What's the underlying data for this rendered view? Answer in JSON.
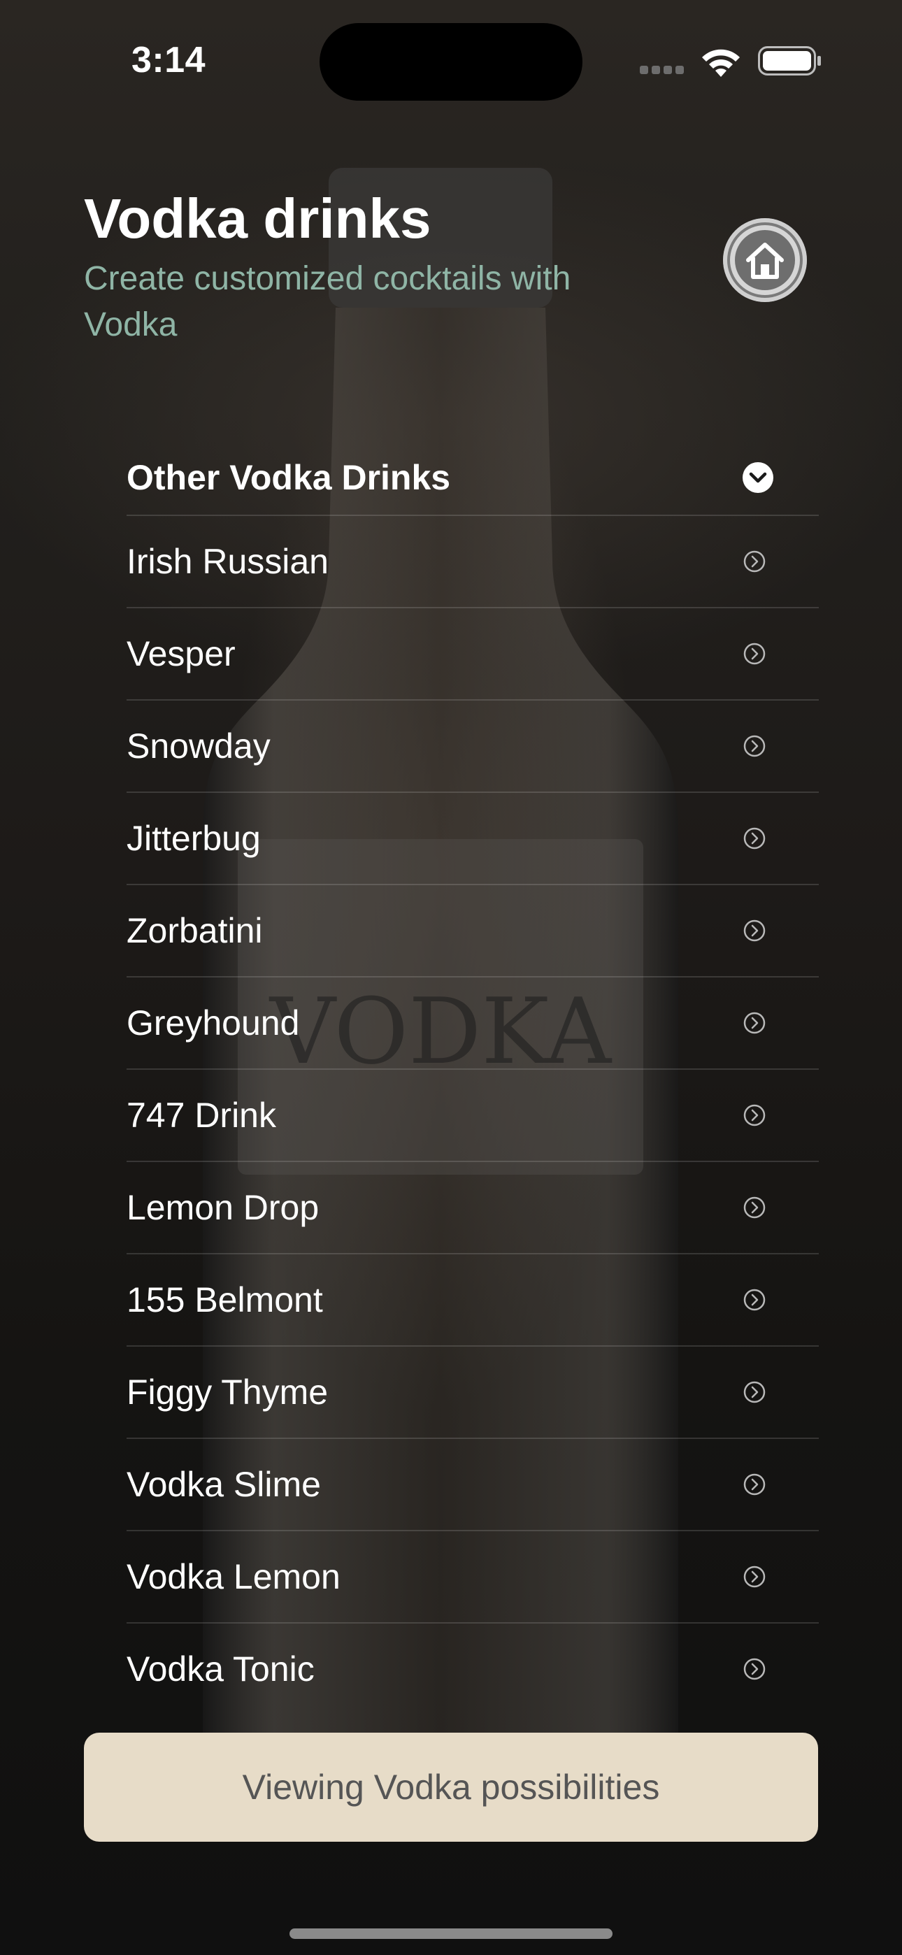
{
  "status_bar": {
    "time": "3:14"
  },
  "header": {
    "title": "Vodka drinks",
    "subtitle": "Create customized cocktails with Vodka"
  },
  "home_button": {
    "icon": "house-icon"
  },
  "drink_list": {
    "section_label": "Other Vodka Drinks",
    "section_icon": "chevron-down-circle-icon",
    "item_icon": "chevron-right-circle-icon",
    "items": [
      "Irish Russian",
      "Vesper",
      "Snowday",
      "Jitterbug",
      "Zorbatini",
      "Greyhound",
      "747 Drink",
      "Lemon Drop",
      "155 Belmont",
      "Figgy Thyme",
      "Vodka Slime",
      "Vodka Lemon",
      "Vodka Tonic"
    ]
  },
  "footer_button": {
    "label": "Viewing Vodka possibilities"
  },
  "colors": {
    "subtitle": "#8fb5a6",
    "button_background": "#e7dcc8",
    "button_text": "#555555"
  }
}
